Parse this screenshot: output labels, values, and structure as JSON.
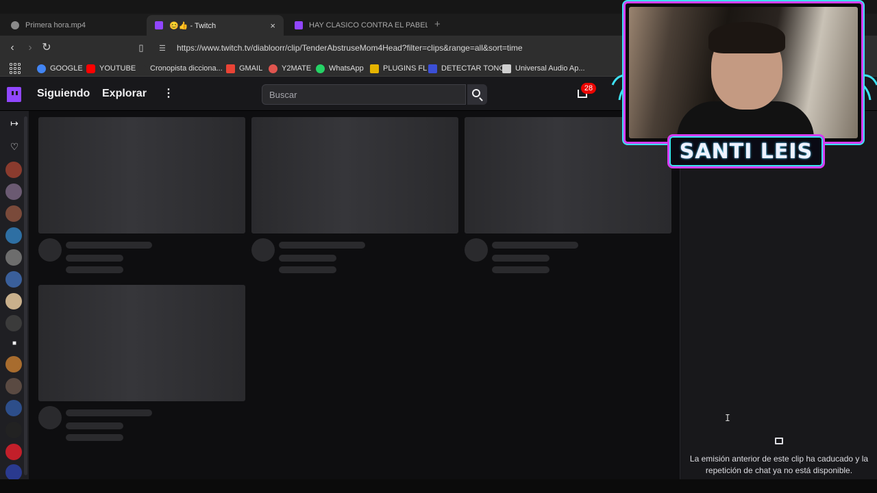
{
  "browser": {
    "tabs": [
      {
        "title": "Primera hora.mp4",
        "active": false
      },
      {
        "title": "😊👍 - Twitch",
        "active": true
      },
      {
        "title": "HAY CLASICO CONTRA EL PABELLON",
        "active": false
      }
    ],
    "close_glyph": "×",
    "new_tab_glyph": "+",
    "url": "https://www.twitch.tv/diabloorr/clip/TenderAbstruseMom4Head?filter=clips&range=all&sort=time"
  },
  "bookmarks": [
    {
      "label": "GOOGLE",
      "color": "#4285f4"
    },
    {
      "label": "YOUTUBE",
      "color": "#ff0000"
    },
    {
      "label": "Cronopista dicciona...",
      "color": "#2e2e2e"
    },
    {
      "label": "GMAIL",
      "color": "#ea4335"
    },
    {
      "label": "Y2MATE",
      "color": "#e0554f"
    },
    {
      "label": "WhatsApp",
      "color": "#25d366"
    },
    {
      "label": "PLUGINS FL",
      "color": "#e6b400"
    },
    {
      "label": "DETECTAR TONO",
      "color": "#3b4fd6"
    },
    {
      "label": "Universal Audio Ap...",
      "color": "#cfcfcf"
    }
  ],
  "twitch": {
    "nav": {
      "following": "Siguiendo",
      "browse": "Explorar",
      "more_glyph": "⋮"
    },
    "search": {
      "placeholder": "Buscar"
    },
    "inbox_count": "28",
    "accent": "#9147ff"
  },
  "sidebar": {
    "expand_glyph": "↦",
    "heart_glyph": "♡",
    "camera_glyph": "■",
    "avatar_colors": [
      "#8a3b2e",
      "#6b5a72",
      "#7a4a3a",
      "#2e6fa3",
      "#6d6d6d",
      "#3a5f9a",
      "#c9b08c",
      "#3b3b3b",
      "#a86c2e",
      "#5a4a42",
      "#2d4e8a",
      "#222222",
      "#c21f2a",
      "#2a3a8f"
    ]
  },
  "chat": {
    "message": "La emisión anterior de este clip ha caducado y la repetición de chat ya no está disponible.",
    "cursor_glyph": "I"
  },
  "overlay": {
    "streamer_name": "SANTI LEIS",
    "frame_colors": [
      "#d63df0",
      "#3ee0f2"
    ]
  }
}
